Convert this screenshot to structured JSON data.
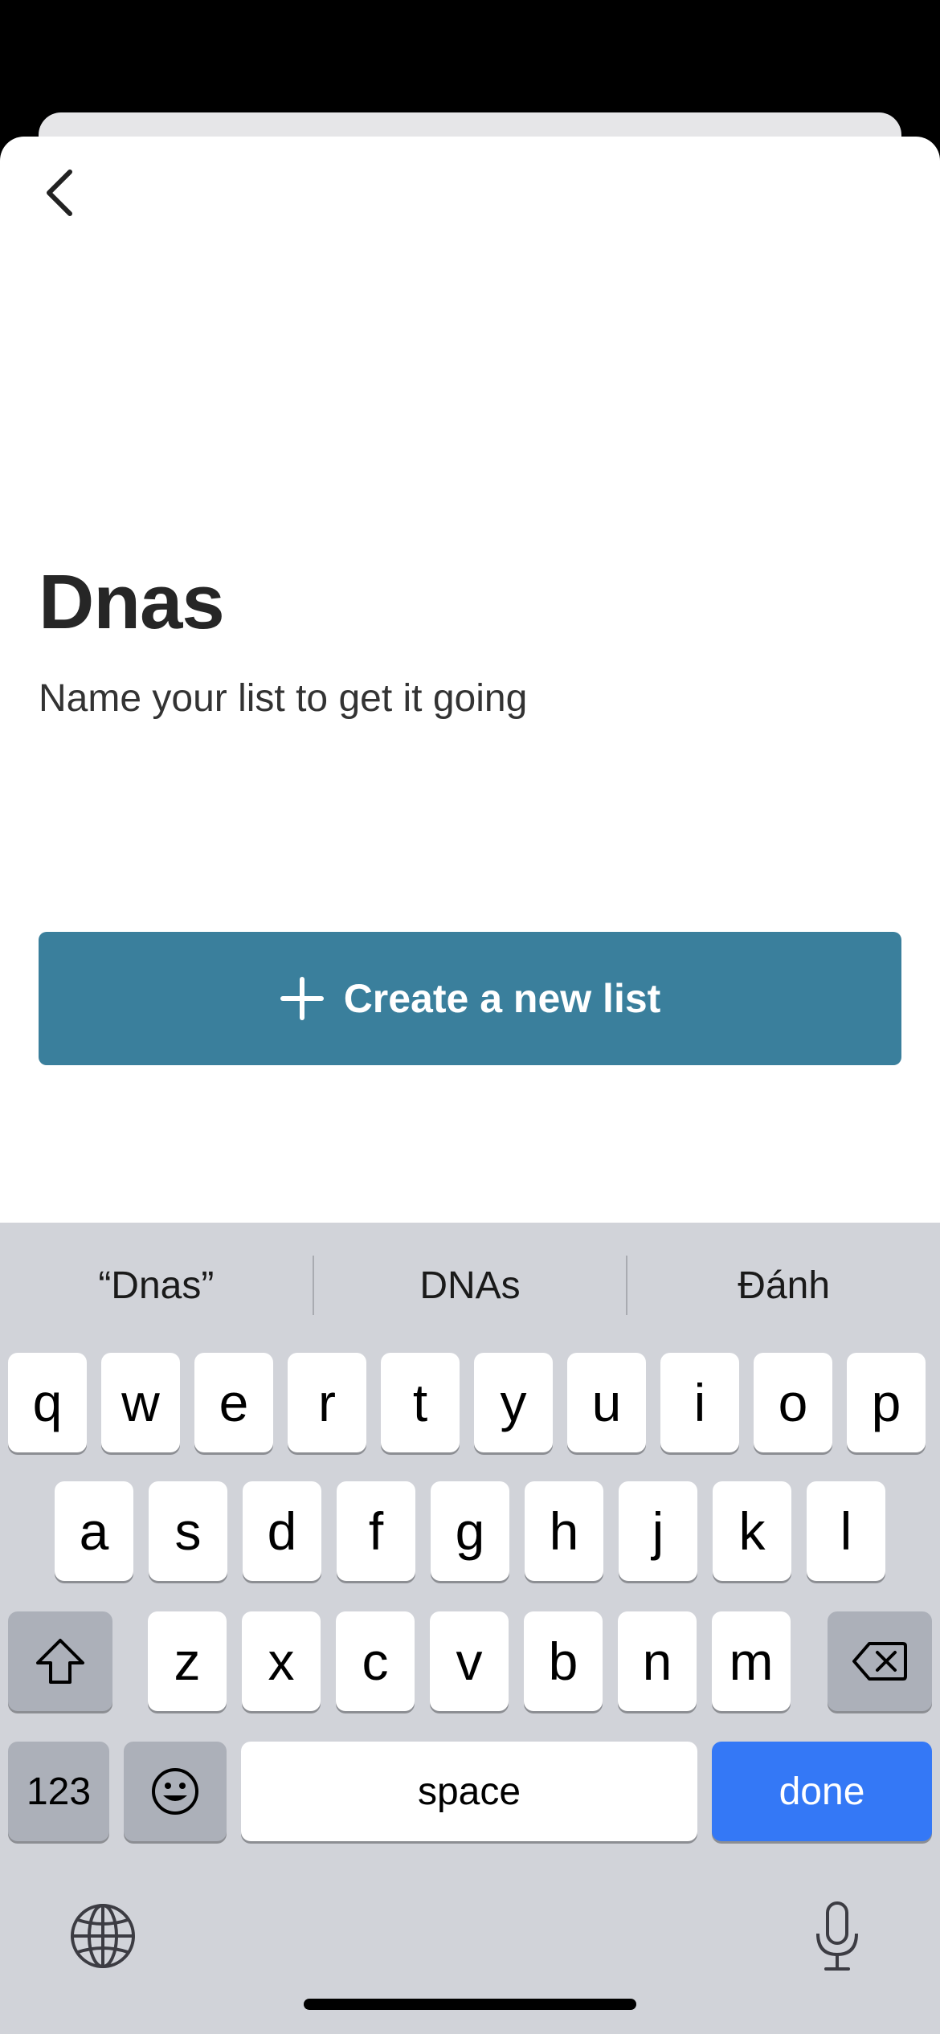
{
  "header": {
    "back_icon": "chevron-left-icon"
  },
  "main": {
    "list_name": "Dnas",
    "subtitle": "Name your list to get it going",
    "create_button": {
      "icon": "plus-icon",
      "label": "Create a new list"
    },
    "accent_color": "#3a7f9c"
  },
  "keyboard": {
    "suggestions": [
      "“Dnas”",
      "DNAs",
      "Đánh"
    ],
    "row1": [
      "q",
      "w",
      "e",
      "r",
      "t",
      "y",
      "u",
      "i",
      "o",
      "p"
    ],
    "row2": [
      "a",
      "s",
      "d",
      "f",
      "g",
      "h",
      "j",
      "k",
      "l"
    ],
    "row3": [
      "z",
      "x",
      "c",
      "v",
      "b",
      "n",
      "m"
    ],
    "shift_icon": "shift-icon",
    "delete_icon": "backspace-icon",
    "numbers_label": "123",
    "emoji_icon": "emoji-icon",
    "space_label": "space",
    "done_label": "done",
    "globe_icon": "globe-icon",
    "mic_icon": "microphone-icon",
    "done_color": "#3478f6"
  }
}
